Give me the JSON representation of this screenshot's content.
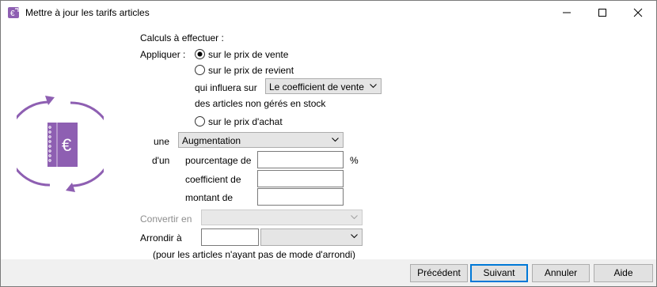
{
  "window": {
    "title": "Mettre à jour les tarifs articles",
    "minimize_icon": "minimize-icon",
    "maximize_icon": "maximize-icon",
    "close_icon": "close-icon"
  },
  "form": {
    "calculs_label": "Calculs à effectuer :",
    "appliquer_label": "Appliquer :",
    "radio_vente": "sur le prix de vente",
    "radio_revient": "sur le prix de revient",
    "qui_influera_label": "qui influera sur",
    "influera_select_value": "Le coefficient de vente",
    "non_geres_label": "des articles non gérés en stock",
    "radio_achat": "sur le prix d'achat",
    "une_label": "une",
    "type_select_value": "Augmentation",
    "dun_label": "d'un",
    "pourcentage_label": "pourcentage de",
    "percent_symbol": "%",
    "coefficient_label": "coefficient de",
    "montant_label": "montant de",
    "pourcentage_value": "",
    "coefficient_value": "",
    "montant_value": "",
    "convertir_label": "Convertir en",
    "convertir_value": "",
    "arrondir_label": "Arrondir à",
    "arrondir_value": "",
    "arrondir_mode_value": "",
    "arrondi_note": "(pour les articles n'ayant pas de mode d'arrondi)",
    "selected_radio": "vente"
  },
  "illustration": {
    "icon": "euro-price-update-icon",
    "color": "#8e5fb2"
  },
  "footer": {
    "precedent": "Précédent",
    "suivant": "Suivant",
    "annuler": "Annuler",
    "aide": "Aide"
  }
}
